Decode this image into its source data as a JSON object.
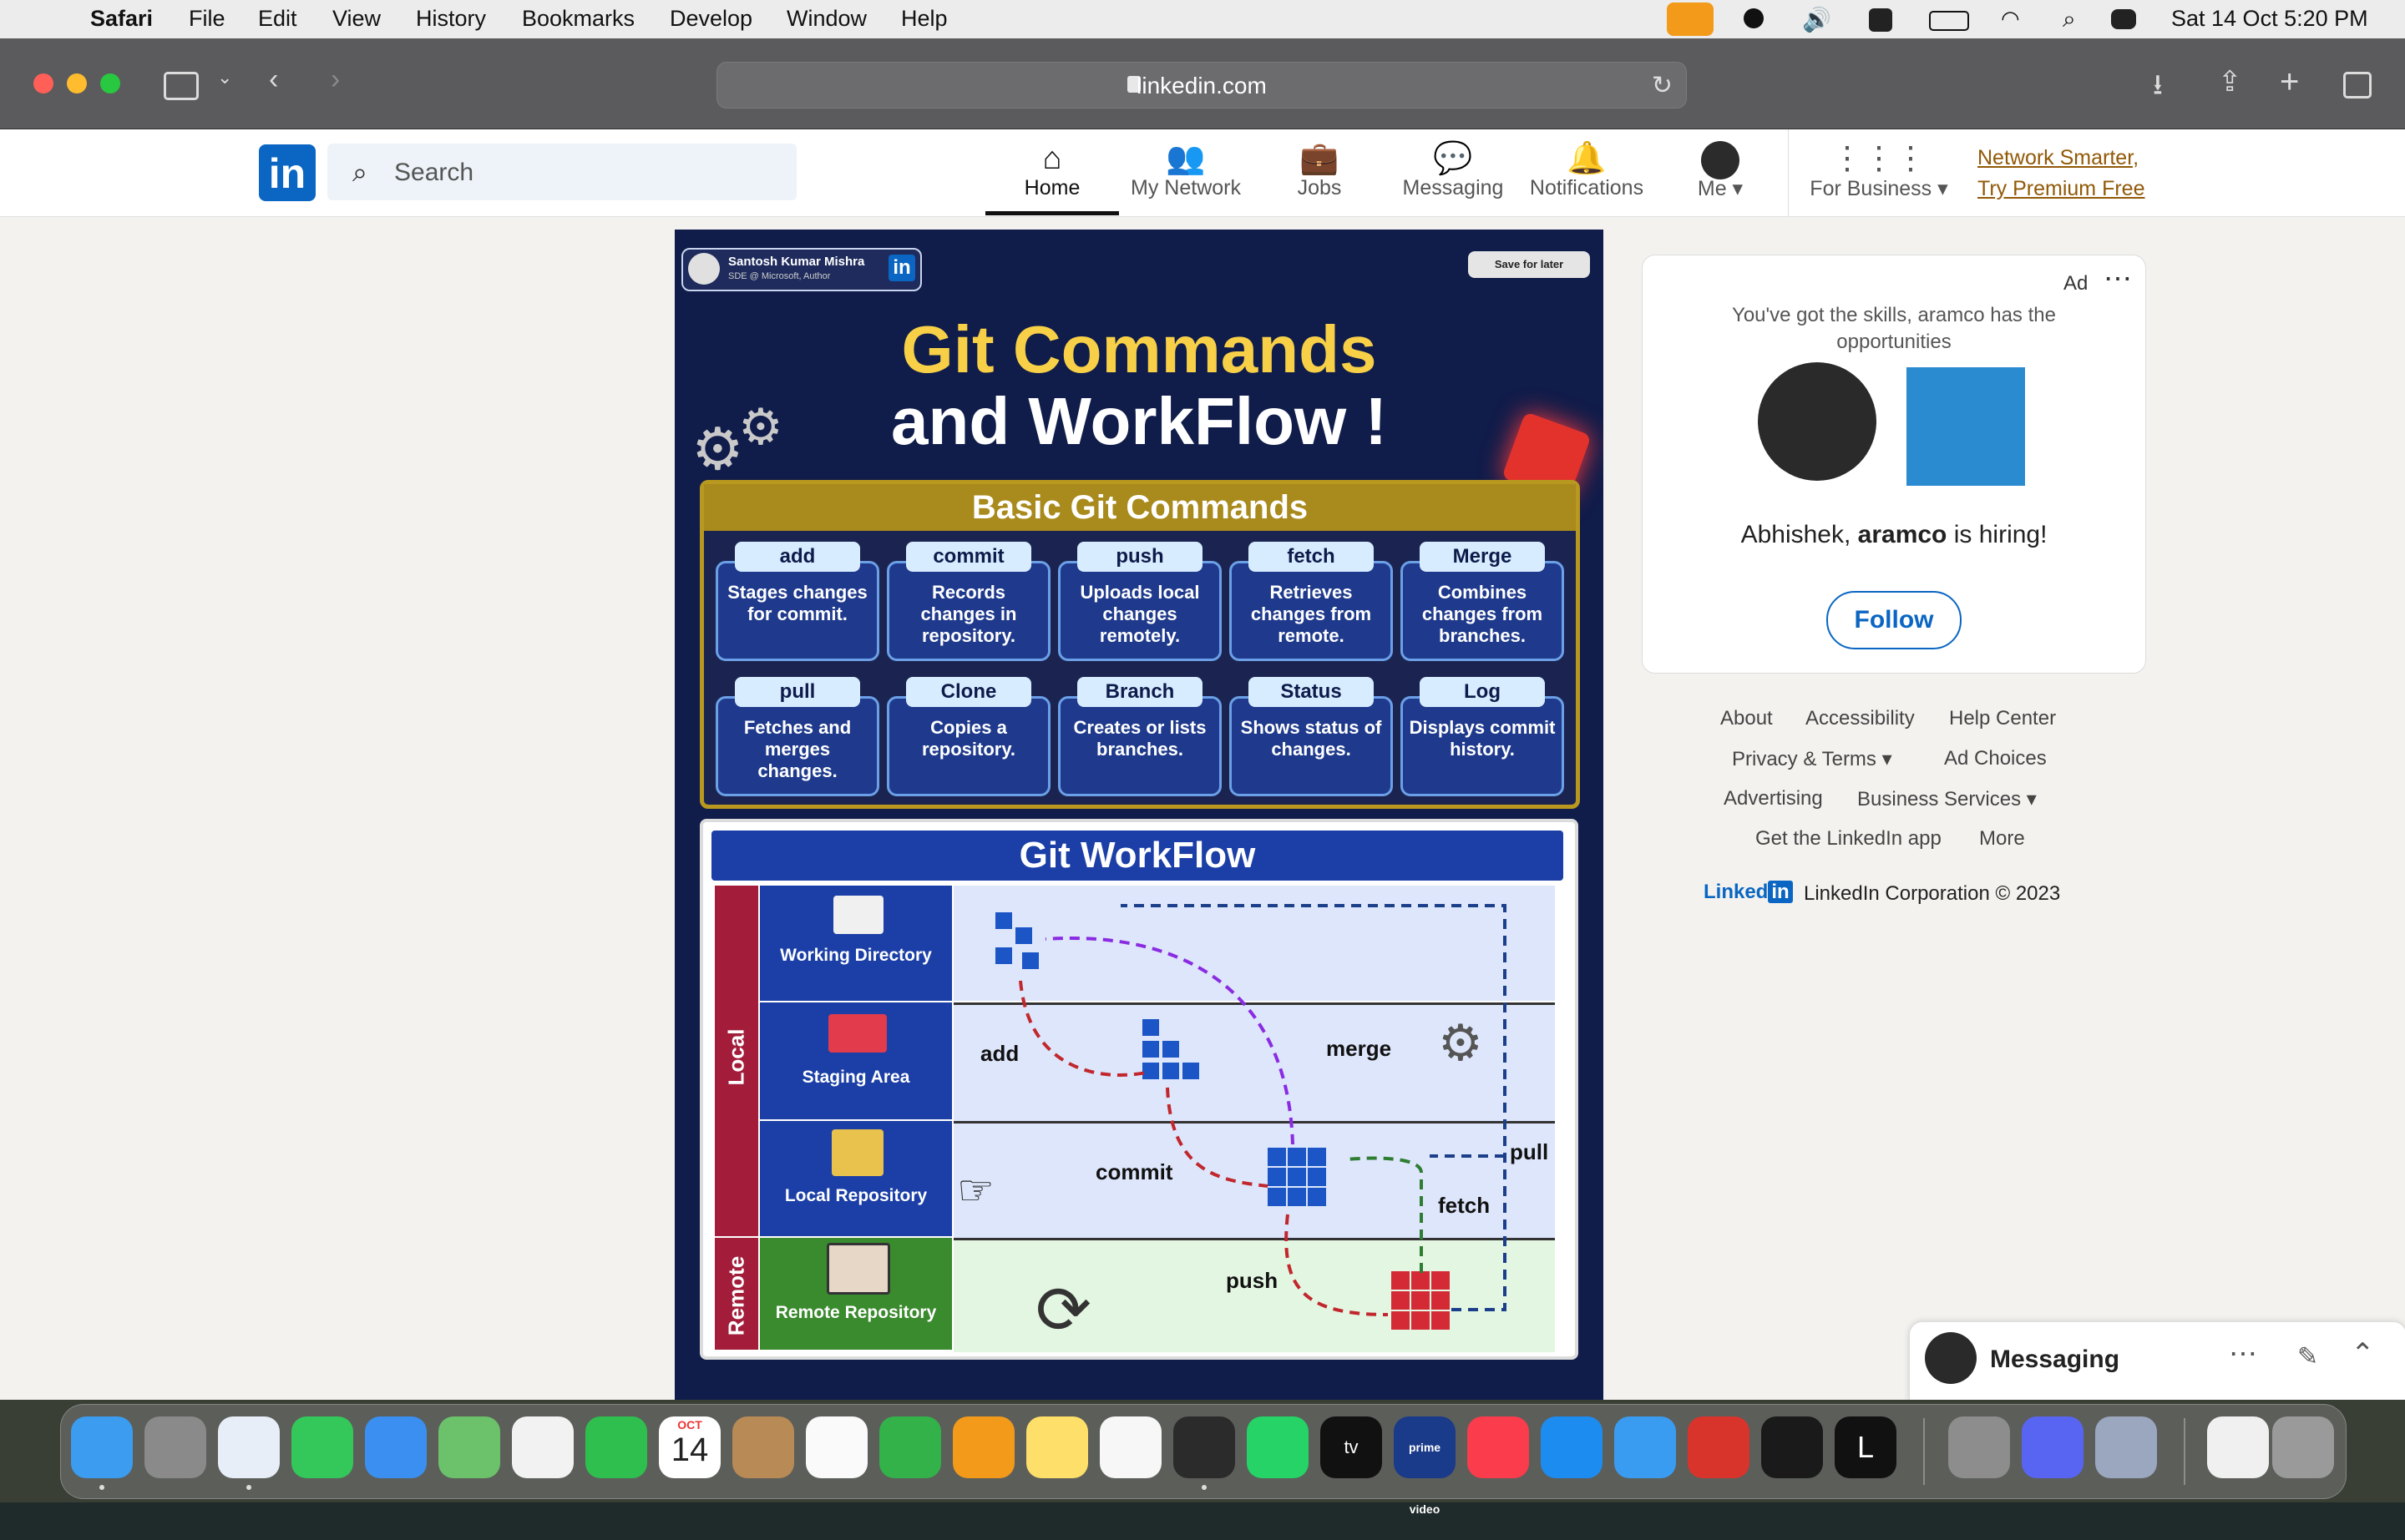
{
  "menubar": {
    "app": "Safari",
    "items": [
      "File",
      "Edit",
      "View",
      "History",
      "Bookmarks",
      "Develop",
      "Window",
      "Help"
    ],
    "datetime": "Sat 14 Oct  5:20 PM"
  },
  "browser": {
    "url": "linkedin.com"
  },
  "linkedin": {
    "logo": "in",
    "search_placeholder": "Search",
    "nav": {
      "home": "Home",
      "network": "My Network",
      "jobs": "Jobs",
      "messaging": "Messaging",
      "notifications": "Notifications",
      "me": "Me",
      "business": "For Business"
    },
    "premium": {
      "line1": "Network Smarter,",
      "line2": "Try Premium Free"
    }
  },
  "post": {
    "author_name": "Santosh Kumar Mishra",
    "author_title": "SDE @ Microsoft, Author",
    "save_label": "Save for later",
    "title_line1": "Git Commands",
    "title_line2": "and WorkFlow !",
    "basic_title": "Basic Git Commands",
    "commands": [
      {
        "label": "add",
        "desc": "Stages changes for commit."
      },
      {
        "label": "commit",
        "desc": "Records changes in repository."
      },
      {
        "label": "push",
        "desc": "Uploads local changes remotely."
      },
      {
        "label": "fetch",
        "desc": "Retrieves changes from remote."
      },
      {
        "label": "Merge",
        "desc": "Combines changes from branches."
      },
      {
        "label": "pull",
        "desc": "Fetches and merges changes."
      },
      {
        "label": "Clone",
        "desc": "Copies a repository."
      },
      {
        "label": "Branch",
        "desc": "Creates or lists branches."
      },
      {
        "label": "Status",
        "desc": "Shows status of changes."
      },
      {
        "label": "Log",
        "desc": "Displays commit history."
      }
    ],
    "workflow_title": "Git WorkFlow",
    "local_label": "Local",
    "remote_label": "Remote",
    "rows": [
      "Working Directory",
      "Staging Area",
      "Local Repository",
      "Remote Repository"
    ],
    "wf_labels": {
      "add": "add",
      "merge": "merge",
      "commit": "commit",
      "pull": "pull",
      "fetch": "fetch",
      "push": "push"
    }
  },
  "ad": {
    "ad_label": "Ad",
    "tagline": "You've got the skills, aramco has the opportunities",
    "hiring_prefix": "Abhishek, ",
    "company": "aramco",
    "hiring_suffix": " is hiring!",
    "follow": "Follow"
  },
  "footer": {
    "about": "About",
    "accessibility": "Accessibility",
    "help": "Help Center",
    "privacy": "Privacy & Terms",
    "adchoices": "Ad Choices",
    "advertising": "Advertising",
    "business": "Business Services",
    "app": "Get the LinkedIn app",
    "more": "More",
    "brand": "Linked",
    "copyright": "LinkedIn Corporation © 2023"
  },
  "messaging": {
    "title": "Messaging"
  },
  "dock": {
    "calendar_month": "OCT",
    "calendar_day": "14",
    "tv_label": "tv",
    "prime_label": "prime video",
    "l_label": "L"
  },
  "colors": {
    "linkedin_blue": "#0a66c2",
    "post_bg": "#101c4a",
    "gold": "#f7d047"
  }
}
